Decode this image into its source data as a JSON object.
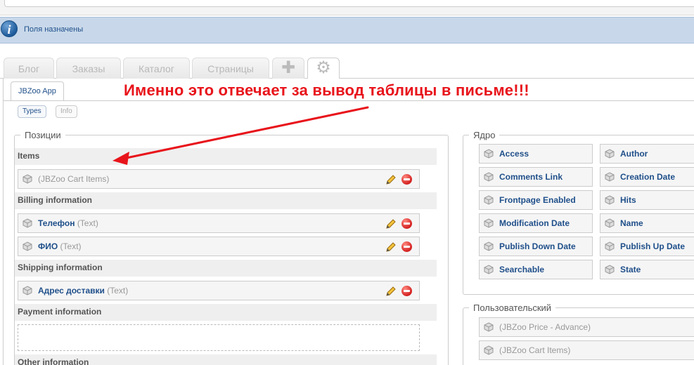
{
  "message": {
    "text": "Поля назначены"
  },
  "main_tabs": [
    {
      "label": "Блог"
    },
    {
      "label": "Заказы"
    },
    {
      "label": "Каталог"
    },
    {
      "label": "Страницы"
    }
  ],
  "sub_tab": {
    "label": "JBZoo App"
  },
  "pills": {
    "types": "Types",
    "info": "Info"
  },
  "annotation": {
    "text": "Именно это отвечает за вывод таблицы в письме!!!"
  },
  "positions": {
    "title": "Позиции",
    "sections": [
      {
        "title": "Items",
        "elements": [
          {
            "name": "(JBZoo Cart Items)",
            "type": ""
          }
        ]
      },
      {
        "title": "Billing information",
        "elements": [
          {
            "name": "Телефон",
            "type": "(Text)"
          },
          {
            "name": "ФИО",
            "type": "(Text)"
          }
        ]
      },
      {
        "title": "Shipping information",
        "elements": [
          {
            "name": "Адрес доставки",
            "type": "(Text)"
          }
        ]
      },
      {
        "title": "Payment information",
        "elements": []
      },
      {
        "title": "Other information",
        "elements": []
      }
    ]
  },
  "core": {
    "title": "Ядро",
    "items": [
      "Access",
      "Author",
      "Comments Link",
      "Creation Date",
      "Frontpage Enabled",
      "Hits",
      "Modification Date",
      "Name",
      "Publish Down Date",
      "Publish Up Date",
      "Searchable",
      "State"
    ]
  },
  "custom": {
    "title": "Пользовательский",
    "items": [
      "(JBZoo Price - Advance)",
      "(JBZoo Cart Items)"
    ]
  },
  "colors": {
    "annotation": "#e8141b",
    "link": "#1f4f8a",
    "message_bg": "#c8d8ea"
  }
}
